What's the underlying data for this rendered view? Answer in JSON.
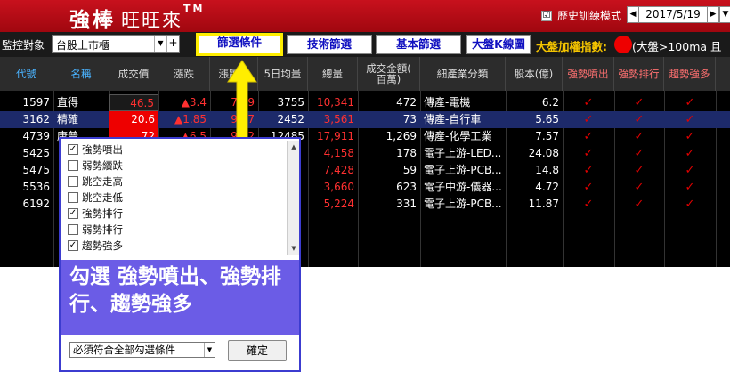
{
  "header": {
    "logo_main": "強棒",
    "logo_sub": "旺旺來",
    "logo_tm": "TM",
    "history_checked": "☑",
    "history_label": "歷史訓練模式",
    "date": "2017/5/19",
    "date_prev": "◀",
    "date_next": "▶",
    "date_dd": "▼"
  },
  "toolbar": {
    "monitor_label": "監控對象",
    "market_value": "台股上市櫃",
    "dd_glyph": "▼",
    "plus_glyph": "+",
    "btn_filter": "篩選條件",
    "btn_tech": "技術篩選",
    "btn_basic": "基本篩選",
    "btn_kline": "大盤K線圖",
    "index_label": "大盤加權指數:",
    "index_cond": "(大盤>100ma 且"
  },
  "table": {
    "headers": [
      "代號",
      "名稱",
      "成交價",
      "漲跌",
      "漲跌%",
      "5日均量",
      "總量",
      "成交金額(\n百萬)",
      "細產業分類",
      "股本(億)",
      "強勢噴出",
      "強勢排行",
      "趨勢強多"
    ],
    "rows": [
      {
        "code": "1597",
        "name": "直得",
        "price": "46.5",
        "chg": "▲3.4",
        "pct": "7.89",
        "avg5": "3755",
        "vol": "10,341",
        "amt": "472",
        "ind": "傳產-電機",
        "cap": "6.2"
      },
      {
        "code": "3162",
        "name": "精確",
        "price": "20.6",
        "chg": "▲1.85",
        "pct": "9.87",
        "avg5": "2452",
        "vol": "3,561",
        "amt": "73",
        "ind": "傳產-自行車",
        "cap": "5.65"
      },
      {
        "code": "4739",
        "name": "康普",
        "price": "72",
        "chg": "▲6.5",
        "pct": "9.92",
        "avg5": "12485",
        "vol": "17,911",
        "amt": "1,269",
        "ind": "傳產-化學工業",
        "cap": "7.57"
      },
      {
        "code": "5425",
        "name": "",
        "price": "",
        "chg": "",
        "pct": "",
        "avg5": "",
        "vol": "4,158",
        "amt": "178",
        "ind": "電子上游-LED...",
        "cap": "24.08"
      },
      {
        "code": "5475",
        "name": "",
        "price": "",
        "chg": "",
        "pct": "",
        "avg5": "",
        "vol": "7,428",
        "amt": "59",
        "ind": "電子上游-PCB...",
        "cap": "14.8"
      },
      {
        "code": "5536",
        "name": "",
        "price": "",
        "chg": "",
        "pct": "",
        "avg5": "",
        "vol": "3,660",
        "amt": "623",
        "ind": "電子中游-儀器...",
        "cap": "4.72"
      },
      {
        "code": "6192",
        "name": "",
        "price": "",
        "chg": "",
        "pct": "",
        "avg5": "",
        "vol": "5,224",
        "amt": "331",
        "ind": "電子上游-PCB...",
        "cap": "11.87"
      }
    ],
    "check_glyph": "✓"
  },
  "popup": {
    "options": [
      {
        "label": "強勢噴出",
        "mark": "✓"
      },
      {
        "label": "弱勢續跌",
        "mark": ""
      },
      {
        "label": "跳空走高",
        "mark": ""
      },
      {
        "label": "跳空走低",
        "mark": ""
      },
      {
        "label": "強勢排行",
        "mark": "✓"
      },
      {
        "label": "弱勢排行",
        "mark": ""
      },
      {
        "label": "趨勢強多",
        "mark": "✓"
      }
    ],
    "callout": "勾選 強勢噴出、強勢排行、趨勢強多",
    "mode_value": "必須符合全部勾選條件",
    "mode_dd": "▼",
    "ok_label": "確定",
    "scroll_up": "▲",
    "scroll_down": "▼"
  },
  "colors": {
    "header_red": "#c8111d",
    "accent_blue": "#1010c0",
    "highlight_yellow": "#ffee00",
    "callout_purple": "#6b5ce6",
    "up_red": "#ff3030"
  }
}
